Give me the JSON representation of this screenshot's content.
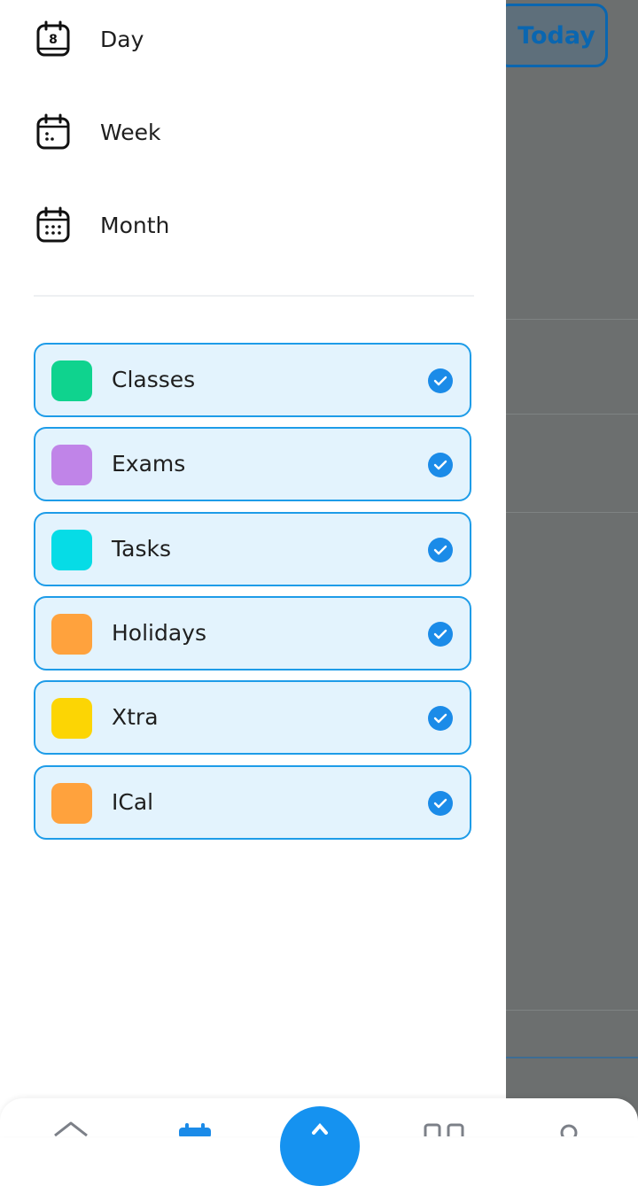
{
  "header": {
    "today_label": "Today"
  },
  "views": [
    {
      "label": "Day",
      "icon": "calendar-day-icon",
      "day_number": "8"
    },
    {
      "label": "Week",
      "icon": "calendar-week-icon"
    },
    {
      "label": "Month",
      "icon": "calendar-month-icon"
    }
  ],
  "categories": [
    {
      "name": "Classes",
      "color": "#0fd38e",
      "checked": true
    },
    {
      "name": "Exams",
      "color": "#c084e8",
      "checked": true
    },
    {
      "name": "Tasks",
      "color": "#06dce6",
      "checked": true
    },
    {
      "name": "Holidays",
      "color": "#ffa23d",
      "checked": true
    },
    {
      "name": "Xtra",
      "color": "#fcd504",
      "checked": true
    },
    {
      "name": "ICal",
      "color": "#ffa23d",
      "checked": true
    }
  ],
  "theme": {
    "accent": "#1b8be8",
    "card_bg": "#e3f3fd",
    "overlay": "#6c6f6f"
  },
  "bottom_nav": {
    "items": [
      "home-icon",
      "calendar-icon",
      "add-fab",
      "grid-icon",
      "profile-icon"
    ]
  }
}
